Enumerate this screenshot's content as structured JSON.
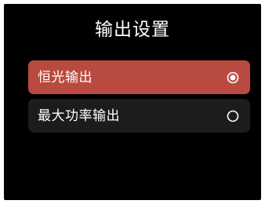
{
  "header": {
    "title": "输出设置"
  },
  "options": [
    {
      "label": "恒光输出",
      "selected": true,
      "icon": "radio-selected-icon"
    },
    {
      "label": "最大功率输出",
      "selected": false,
      "icon": "radio-unselected-icon"
    }
  ],
  "colors": {
    "background": "#000000",
    "selected_option": "#b94a3f",
    "unselected_option": "#1c1c1c",
    "text": "#ffffff"
  }
}
